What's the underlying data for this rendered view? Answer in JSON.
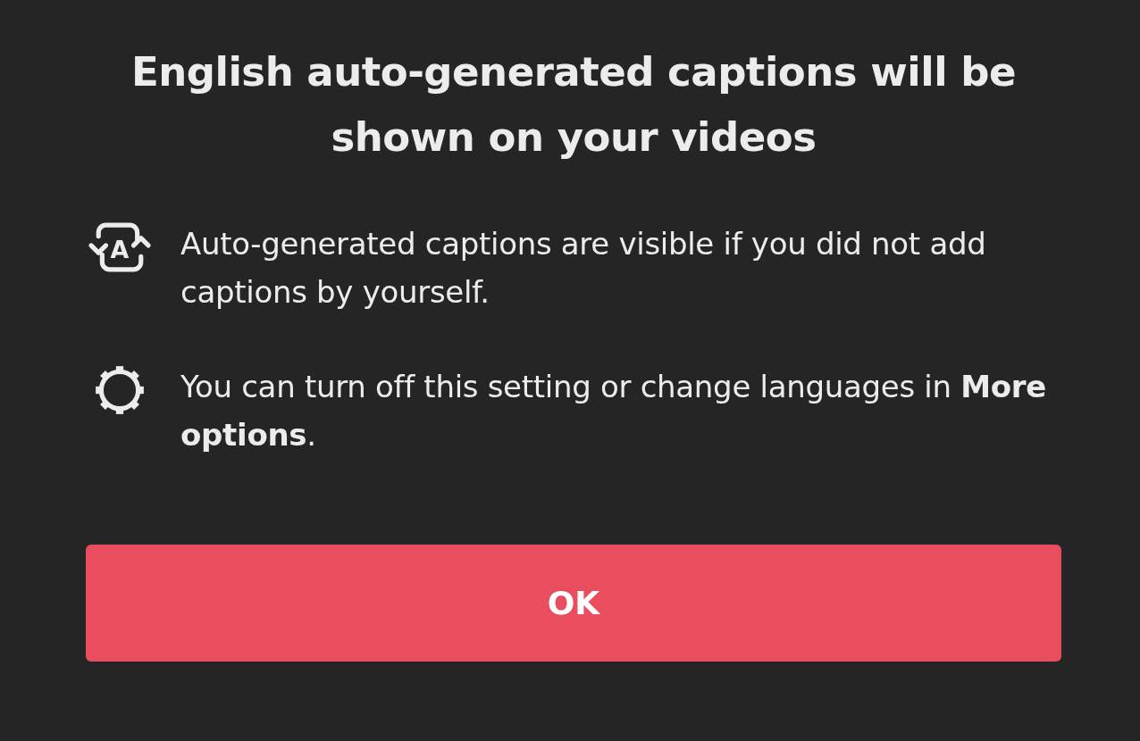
{
  "title": "English auto-generated captions will be shown on your videos",
  "items": [
    {
      "kind": "captions",
      "icon_letter": "A",
      "text": "Auto-generated captions are visible if you did not add captions by yourself."
    },
    {
      "kind": "settings",
      "text": "You can turn off this setting or change languages in **More options**."
    }
  ],
  "button": {
    "label": "OK"
  }
}
